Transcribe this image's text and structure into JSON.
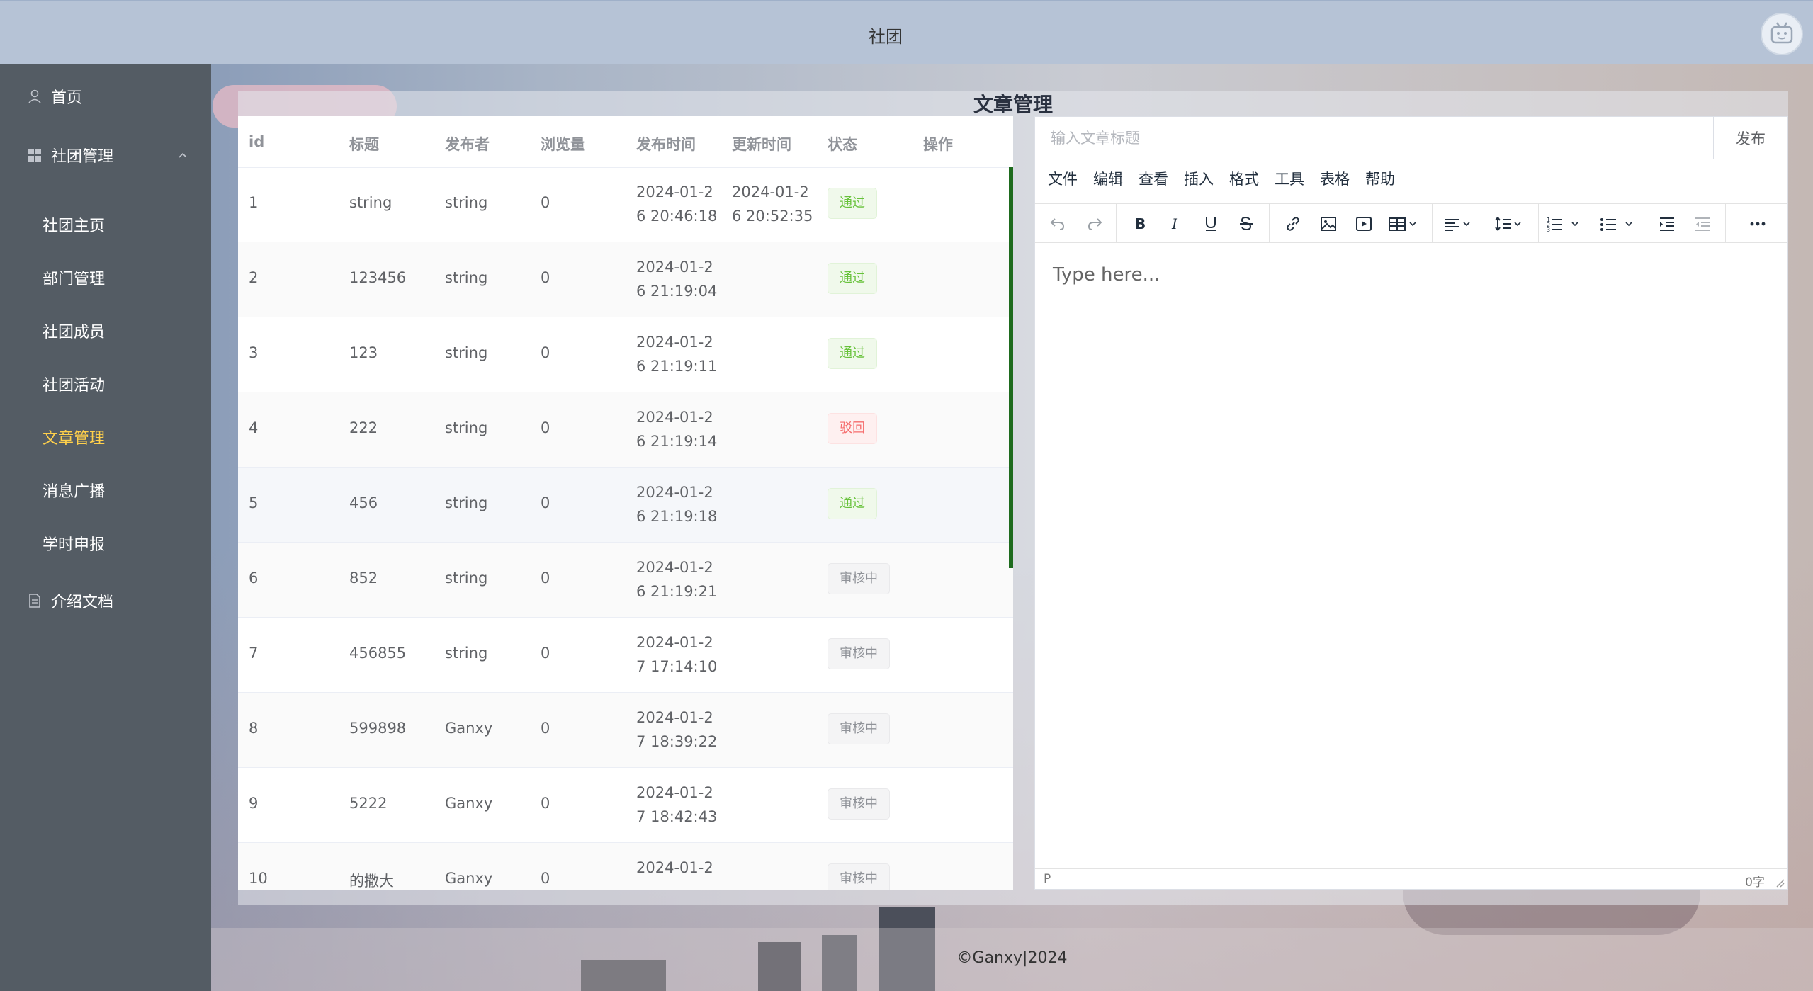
{
  "header": {
    "title": "社团"
  },
  "sidebar": {
    "home": "首页",
    "club_mgmt": "社团管理",
    "sub": [
      "社团主页",
      "部门管理",
      "社团成员",
      "社团活动",
      "文章管理",
      "消息广播",
      "学时申报"
    ],
    "docs": "介绍文档"
  },
  "page": {
    "title": "文章管理"
  },
  "table": {
    "headers": [
      "id",
      "标题",
      "发布者",
      "浏览量",
      "发布时间",
      "更新时间",
      "状态",
      "操作"
    ],
    "rows": [
      {
        "id": "1",
        "title": "string",
        "publisher": "string",
        "views": "0",
        "published": "2024-01-26 20:46:18",
        "updated": "2024-01-26 20:52:35",
        "status": "通过"
      },
      {
        "id": "2",
        "title": "123456",
        "publisher": "string",
        "views": "0",
        "published": "2024-01-26 21:19:04",
        "updated": "",
        "status": "通过"
      },
      {
        "id": "3",
        "title": "123",
        "publisher": "string",
        "views": "0",
        "published": "2024-01-26 21:19:11",
        "updated": "",
        "status": "通过"
      },
      {
        "id": "4",
        "title": "222",
        "publisher": "string",
        "views": "0",
        "published": "2024-01-26 21:19:14",
        "updated": "",
        "status": "驳回"
      },
      {
        "id": "5",
        "title": "456",
        "publisher": "string",
        "views": "0",
        "published": "2024-01-26 21:19:18",
        "updated": "",
        "status": "通过"
      },
      {
        "id": "6",
        "title": "852",
        "publisher": "string",
        "views": "0",
        "published": "2024-01-26 21:19:21",
        "updated": "",
        "status": "审核中"
      },
      {
        "id": "7",
        "title": "456855",
        "publisher": "string",
        "views": "0",
        "published": "2024-01-27 17:14:10",
        "updated": "",
        "status": "审核中"
      },
      {
        "id": "8",
        "title": "599898",
        "publisher": "Ganxy",
        "views": "0",
        "published": "2024-01-27 18:39:22",
        "updated": "",
        "status": "审核中"
      },
      {
        "id": "9",
        "title": "5222",
        "publisher": "Ganxy",
        "views": "0",
        "published": "2024-01-27 18:42:43",
        "updated": "",
        "status": "审核中"
      },
      {
        "id": "10",
        "title": "的撒大",
        "publisher": "Ganxy",
        "views": "0",
        "published": "2024-01-2",
        "updated": "",
        "status": "审核中"
      }
    ]
  },
  "editor": {
    "title_placeholder": "输入文章标题",
    "publish": "发布",
    "menus": [
      "文件",
      "编辑",
      "查看",
      "插入",
      "格式",
      "工具",
      "表格",
      "帮助"
    ],
    "body_placeholder": "Type here...",
    "status_path": "P",
    "word_count": "0字"
  },
  "footer": {
    "text": "©Ganxy|2024"
  },
  "colors": {
    "sidebar": "#545c64",
    "active": "#ffd04b",
    "ok": "#67c23a",
    "bad": "#f56c6c",
    "pending": "#909399"
  }
}
